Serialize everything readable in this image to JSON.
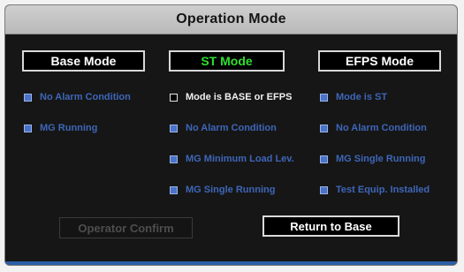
{
  "window": {
    "title": "Operation Mode"
  },
  "modes": [
    {
      "label": "Base Mode",
      "active": false
    },
    {
      "label": "ST Mode",
      "active": true
    },
    {
      "label": "EFPS Mode",
      "active": false
    }
  ],
  "columns": {
    "base": [
      {
        "label": "No Alarm Condition",
        "checked": true
      },
      {
        "label": "MG Running",
        "checked": true
      }
    ],
    "st": [
      {
        "label": "Mode is BASE or EFPS",
        "checked": false
      },
      {
        "label": "No Alarm Condition",
        "checked": true
      },
      {
        "label": "MG Minimum Load Lev.",
        "checked": true
      },
      {
        "label": "MG Single Running",
        "checked": true
      }
    ],
    "efps": [
      {
        "label": "Mode is ST",
        "checked": true
      },
      {
        "label": "No Alarm Condition",
        "checked": true
      },
      {
        "label": "MG Single Running",
        "checked": true
      },
      {
        "label": "Test Equip. Installed",
        "checked": true
      }
    ]
  },
  "actions": {
    "operator_confirm": "Operator Confirm",
    "return_to_base": "Return to Base"
  },
  "colors": {
    "active_mode_text": "#2ee02e",
    "condition_text": "#3e66b8",
    "indicator_on": "#4a73c9"
  }
}
